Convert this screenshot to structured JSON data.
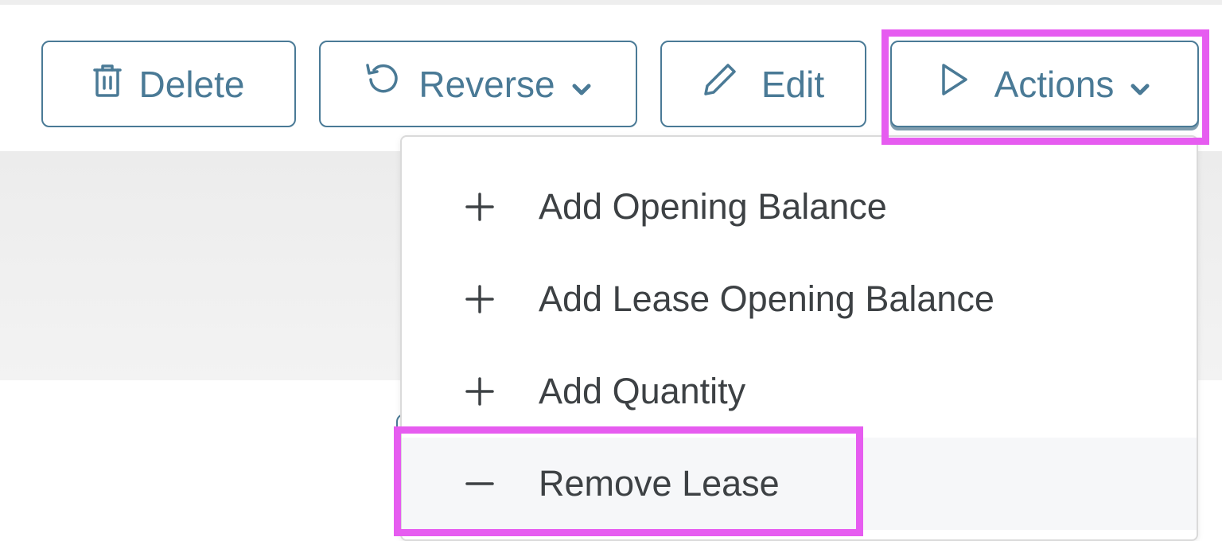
{
  "toolbar": {
    "delete_label": "Delete",
    "reverse_label": "Reverse",
    "edit_label": "Edit",
    "actions_label": "Actions"
  },
  "actions_menu": {
    "items": [
      {
        "icon": "plus-icon",
        "label": "Add Opening Balance"
      },
      {
        "icon": "plus-icon",
        "label": "Add Lease Opening Balance"
      },
      {
        "icon": "plus-icon",
        "label": "Add Quantity"
      },
      {
        "icon": "minus-icon",
        "label": "Remove Lease"
      }
    ]
  },
  "colors": {
    "button_accent": "#4a7a96",
    "highlight": "#e65cf0",
    "menu_text": "#3d4144"
  }
}
